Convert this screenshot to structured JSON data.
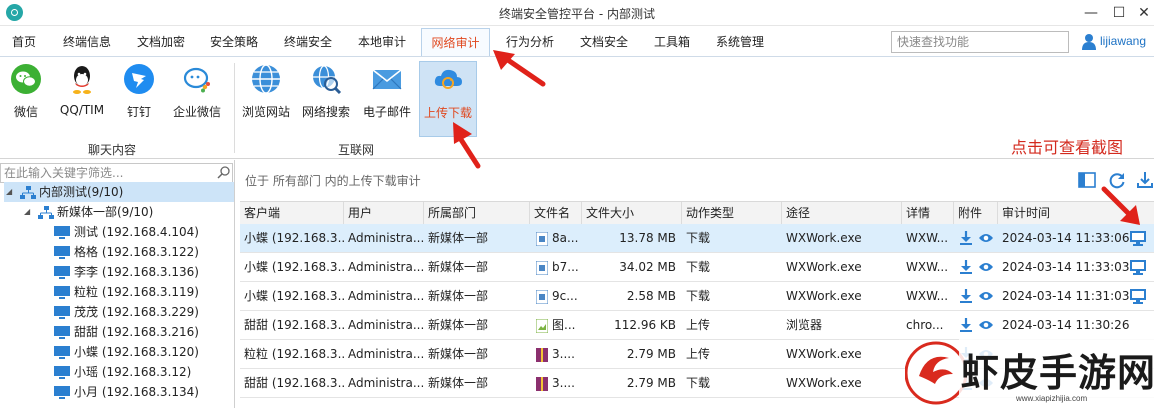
{
  "window": {
    "title": "终端安全管控平台 - 内部测试",
    "minimize": "—",
    "maximize": "☐",
    "close": "✕"
  },
  "menu": {
    "items": [
      "首页",
      "终端信息",
      "文档加密",
      "安全策略",
      "终端安全",
      "本地审计",
      "网络审计",
      "行为分析",
      "文档安全",
      "工具箱",
      "系统管理"
    ],
    "active": "网络审计",
    "search_placeholder": "快速查找功能",
    "user": "lijiawang"
  },
  "ribbon": {
    "chat_group_label": "聊天内容",
    "internet_group_label": "互联网",
    "chat_buttons": [
      {
        "label": "微信",
        "icon": "wechat-icon"
      },
      {
        "label": "QQ/TIM",
        "icon": "qq-icon"
      },
      {
        "label": "钉钉",
        "icon": "dingtalk-icon"
      },
      {
        "label": "企业微信",
        "icon": "wecom-icon"
      }
    ],
    "internet_buttons": [
      {
        "label": "浏览网站",
        "icon": "globe-icon"
      },
      {
        "label": "网络搜索",
        "icon": "search-globe-icon"
      },
      {
        "label": "电子邮件",
        "icon": "email-icon"
      },
      {
        "label": "上传下载",
        "icon": "cloud-sync-icon"
      }
    ],
    "active": "上传下载"
  },
  "annotation": "点击可查看截图",
  "tree": {
    "search_placeholder": "在此输入关键字筛选...",
    "root": "内部测试(9/10)",
    "group": "新媒体一部(9/10)",
    "items": [
      "测试 (192.168.4.104)",
      "格格 (192.168.3.122)",
      "李李 (192.168.3.136)",
      "粒粒 (192.168.3.119)",
      "茂茂 (192.168.3.229)",
      "甜甜 (192.168.3.216)",
      "小蝶 (192.168.3.120)",
      "小瑶 (192.168.3.12)",
      "小月 (192.168.3.134)"
    ]
  },
  "location": "位于 所有部门 内的上传下载审计",
  "grid": {
    "columns": [
      "客户端",
      "用户",
      "所属部门",
      "文件名",
      "文件大小",
      "动作类型",
      "途径",
      "详情",
      "附件",
      "审计时间"
    ],
    "rows": [
      {
        "client": "小蝶 (192.168.3...",
        "user": "Administra...",
        "dept": "新媒体一部",
        "file": "8a...",
        "size": "13.78 MB",
        "action": "下载",
        "via": "WXWork.exe",
        "detail": "WXW...",
        "time": "2024-03-14 11:33:06",
        "shot": true
      },
      {
        "client": "小蝶 (192.168.3...",
        "user": "Administra...",
        "dept": "新媒体一部",
        "file": "b7...",
        "size": "34.02 MB",
        "action": "下载",
        "via": "WXWork.exe",
        "detail": "WXW...",
        "time": "2024-03-14 11:33:03",
        "shot": true
      },
      {
        "client": "小蝶 (192.168.3...",
        "user": "Administra...",
        "dept": "新媒体一部",
        "file": "9c...",
        "size": "2.58 MB",
        "action": "下载",
        "via": "WXWork.exe",
        "detail": "WXW...",
        "time": "2024-03-14 11:31:03",
        "shot": true
      },
      {
        "client": "甜甜 (192.168.3...",
        "user": "Administra...",
        "dept": "新媒体一部",
        "file": "图...",
        "size": "112.96 KB",
        "action": "上传",
        "via": "浏览器",
        "detail": "chro...",
        "time": "2024-03-14 11:30:26",
        "shot": false
      },
      {
        "client": "粒粒 (192.168.3...",
        "user": "Administra...",
        "dept": "新媒体一部",
        "file": "3....",
        "size": "2.79 MB",
        "action": "上传",
        "via": "WXWork.exe",
        "detail": "",
        "time": "",
        "shot": false
      },
      {
        "client": "甜甜 (192.168.3...",
        "user": "Administra...",
        "dept": "新媒体一部",
        "file": "3....",
        "size": "2.79 MB",
        "action": "下载",
        "via": "WXWork.exe",
        "detail": "",
        "time": "",
        "shot": false
      }
    ]
  },
  "watermark": {
    "text": "虾皮手游网",
    "url": "www.xiapizhijia.com"
  },
  "colors": {
    "accent_red": "#e0481f",
    "link_blue": "#1d72c4",
    "selected_row": "#dceefc"
  }
}
